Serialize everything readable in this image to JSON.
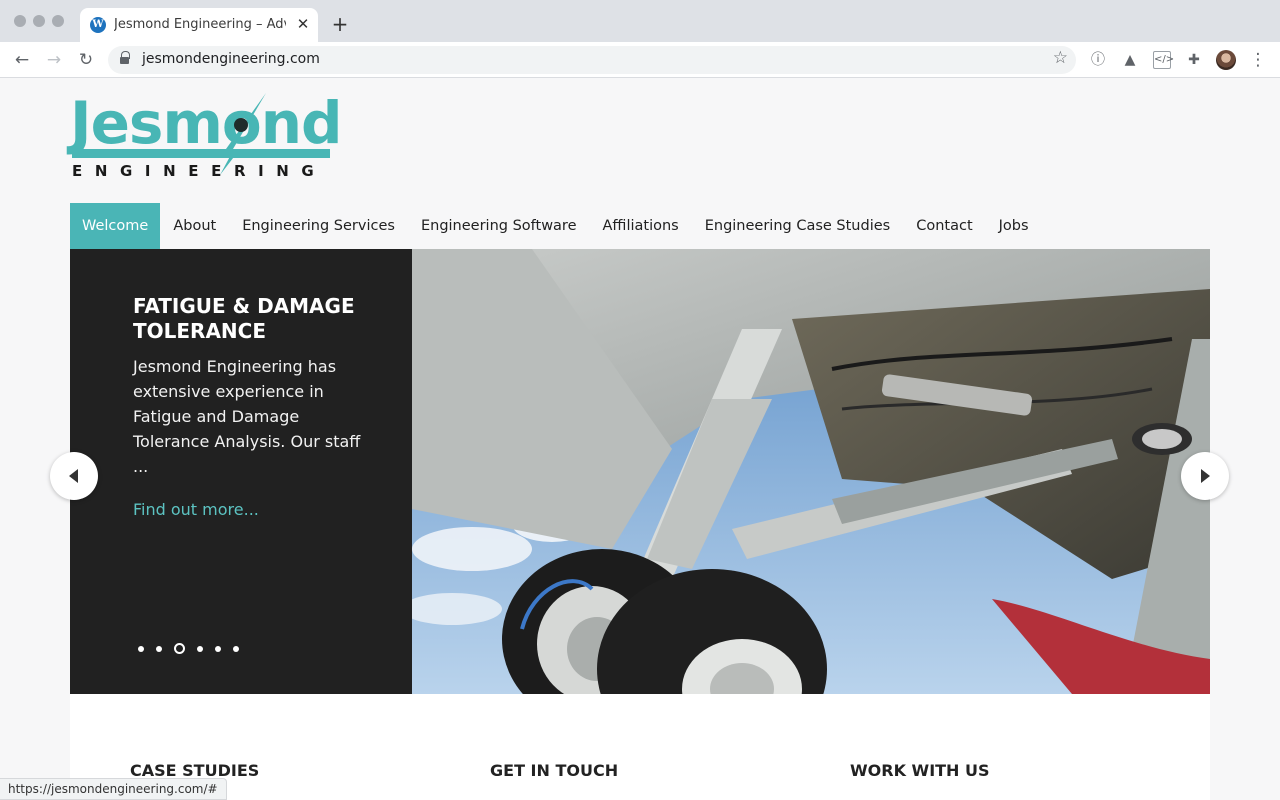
{
  "browser": {
    "tab_title": "Jesmond Engineering – Advanced",
    "url": "jesmondengineering.com",
    "status_url": "https://jesmondengineering.com/#"
  },
  "logo": {
    "word": "Jesmond",
    "sub": "ENGINEERING"
  },
  "nav": {
    "items": [
      {
        "label": "Welcome",
        "active": true
      },
      {
        "label": "About"
      },
      {
        "label": "Engineering Services"
      },
      {
        "label": "Engineering Software"
      },
      {
        "label": "Affiliations"
      },
      {
        "label": "Engineering Case Studies"
      },
      {
        "label": "Contact"
      },
      {
        "label": "Jobs"
      }
    ]
  },
  "slider": {
    "title": "FATIGUE & DAMAGE TOLERANCE",
    "body": "Jesmond Engineering has extensive experience in Fatigue and Damage Tolerance Analysis. Our staff ...",
    "link": "Find out more...",
    "slide_count": 6,
    "active_slide": 3
  },
  "sections": {
    "case_studies": "CASE STUDIES",
    "get_in_touch": "GET IN TOUCH",
    "work_with_us": "WORK WITH US"
  },
  "colors": {
    "brand_teal": "#48b6b5",
    "panel_dark": "#212121"
  }
}
